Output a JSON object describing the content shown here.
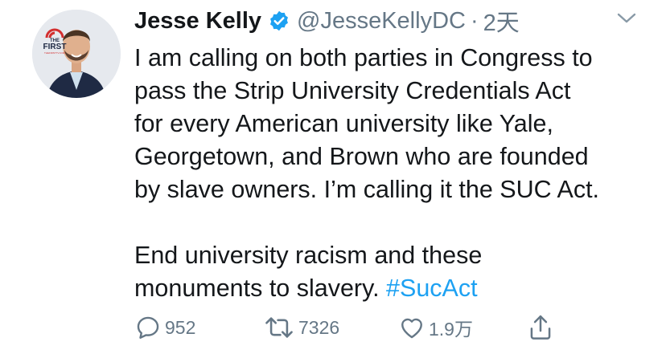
{
  "tweet": {
    "author_name": "Jesse Kelly",
    "handle": "@JesseKellyDC",
    "separator": "·",
    "time": "2天",
    "avatar_badge": {
      "line1": "THE",
      "line2": "FIRST",
      "line3": "THEFIRSTTV.COM"
    },
    "text_lines": [
      "I am calling on both parties in Congress to",
      "pass the Strip University Credentials Act",
      "for every American university like Yale,",
      "Georgetown, and Brown who are founded",
      "by slave owners. I’m calling it the SUC Act."
    ],
    "text_lines_2": [
      "End university racism and these"
    ],
    "last_line_text": "monuments to slavery. ",
    "hashtag": "#SucAct"
  },
  "actions": {
    "reply_count": "952",
    "retweet_count": "7326",
    "like_count": "1.9万"
  },
  "icons": {
    "verified": "verified-badge-icon",
    "chevron": "chevron-down-icon",
    "reply": "reply-icon",
    "retweet": "retweet-icon",
    "like": "heart-icon",
    "share": "share-icon"
  },
  "colors": {
    "text": "#14171a",
    "secondary": "#657786",
    "accent": "#1da1f2"
  }
}
